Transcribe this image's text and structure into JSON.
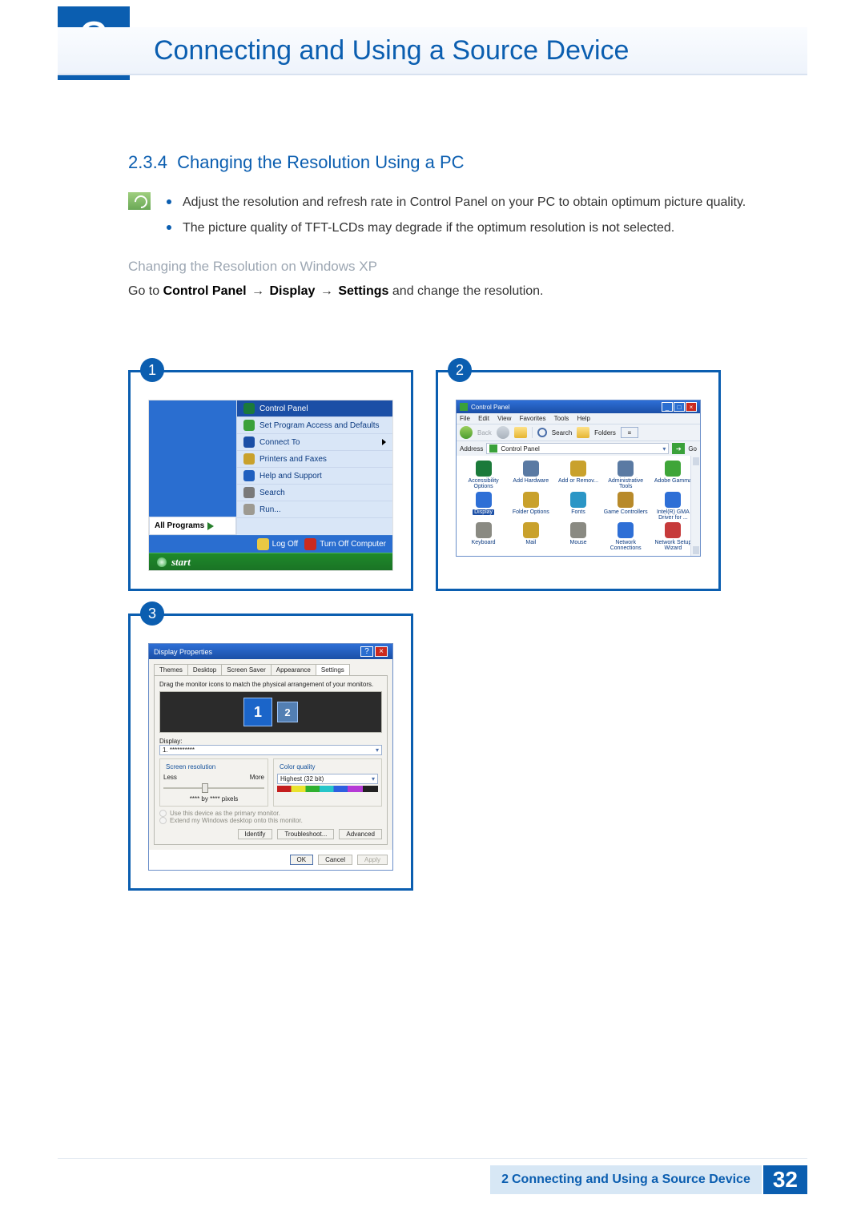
{
  "chapter": {
    "number": "2",
    "title": "Connecting and Using a Source Device"
  },
  "section": {
    "number": "2.3.4",
    "title": "Changing the Resolution Using a PC"
  },
  "notes": {
    "n1": "Adjust the resolution and refresh rate in Control Panel on your PC to obtain optimum picture quality.",
    "n2": "The picture quality of TFT-LCDs may degrade if the optimum resolution is not selected."
  },
  "sub_heading": "Changing the Resolution on Windows XP",
  "instruction": {
    "pre": "Go to ",
    "p1": "Control Panel",
    "arrow": "→",
    "p2": "Display",
    "p3": "Settings",
    "post": " and change the resolution."
  },
  "steps": {
    "s1": "1",
    "s2": "2",
    "s3": "3"
  },
  "startmenu": {
    "all_programs": "All Programs",
    "items": [
      {
        "label": "Control Panel",
        "ic": "#1b7a3a",
        "hl": true
      },
      {
        "label": "Set Program Access and Defaults",
        "ic": "#3aa13a"
      },
      {
        "label": "Connect To",
        "ic": "#1b4fa6",
        "arrow": true
      },
      {
        "label": "Printers and Faxes",
        "ic": "#c9a12c"
      },
      {
        "label": "Help and Support",
        "ic": "#1f5fbf"
      },
      {
        "label": "Search",
        "ic": "#7a7a7a"
      },
      {
        "label": "Run...",
        "ic": "#9d9a92"
      }
    ],
    "logoff": "Log Off",
    "turnoff": "Turn Off Computer",
    "start": "start"
  },
  "cp": {
    "title": "Control Panel",
    "menu": {
      "file": "File",
      "edit": "Edit",
      "view": "View",
      "fav": "Favorites",
      "tools": "Tools",
      "help": "Help"
    },
    "back": "Back",
    "search": "Search",
    "folders": "Folders",
    "address_label": "Address",
    "address_value": "Control Panel",
    "go": "Go",
    "icons": [
      {
        "l": "Accessibility Options",
        "c": "#1b7a3a"
      },
      {
        "l": "Add Hardware",
        "c": "#5a7aa3"
      },
      {
        "l": "Add or Remov...",
        "c": "#c9a12c"
      },
      {
        "l": "Administrative Tools",
        "c": "#5a7aa3"
      },
      {
        "l": "Adobe Gamma",
        "c": "#3fa539"
      },
      {
        "l": "Display",
        "c": "#2e6fd6",
        "sel": true
      },
      {
        "l": "Folder Options",
        "c": "#c9a12c"
      },
      {
        "l": "Fonts",
        "c": "#2b96c6"
      },
      {
        "l": "Game Controllers",
        "c": "#b88a2a"
      },
      {
        "l": "Intel(R) GMA Driver for ...",
        "c": "#2e6fd6"
      },
      {
        "l": "Keyboard",
        "c": "#8a8a82"
      },
      {
        "l": "Mail",
        "c": "#c9a12c"
      },
      {
        "l": "Mouse",
        "c": "#8a8a82"
      },
      {
        "l": "Network Connections",
        "c": "#2e6fd6"
      },
      {
        "l": "Network Setup Wizard",
        "c": "#c63a3a"
      }
    ]
  },
  "dp": {
    "title": "Display Properties",
    "tabs": {
      "themes": "Themes",
      "desktop": "Desktop",
      "ss": "Screen Saver",
      "app": "Appearance",
      "settings": "Settings"
    },
    "hint": "Drag the monitor icons to match the physical arrangement of your monitors.",
    "mon1": "1",
    "mon2": "2",
    "display_label": "Display:",
    "display_value": "1. **********",
    "sr_legend": "Screen resolution",
    "sr_less": "Less",
    "sr_more": "More",
    "sr_value": "**** by **** pixels",
    "cq_legend": "Color quality",
    "cq_value": "Highest (32 bit)",
    "chk1": "Use this device as the primary monitor.",
    "chk2": "Extend my Windows desktop onto this monitor.",
    "btn_identify": "Identify",
    "btn_ts": "Troubleshoot...",
    "btn_adv": "Advanced",
    "btn_ok": "OK",
    "btn_cancel": "Cancel",
    "btn_apply": "Apply"
  },
  "footer": {
    "chapter_line": "2 Connecting and Using a Source Device",
    "page": "32"
  }
}
